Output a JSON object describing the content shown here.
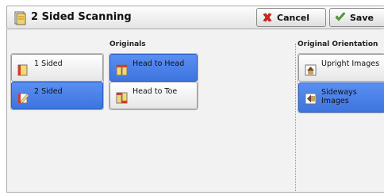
{
  "header": {
    "title": "2 Sided Scanning",
    "cancel_label": "Cancel",
    "save_label": "Save"
  },
  "sides": {
    "options": [
      {
        "label": "1 Sided",
        "selected": false
      },
      {
        "label": "2 Sided",
        "selected": true
      }
    ]
  },
  "originals": {
    "heading": "Originals",
    "options": [
      {
        "label": "Head to Head",
        "selected": true
      },
      {
        "label": "Head to Toe",
        "selected": false
      }
    ]
  },
  "orientation": {
    "heading": "Original Orientation",
    "options": [
      {
        "label": "Upright Images",
        "selected": false
      },
      {
        "label": "Sideways Images",
        "selected": true
      }
    ]
  },
  "colors": {
    "selected": "#4a82e8",
    "cancel_icon": "#d8261c",
    "save_icon": "#4caf2a"
  }
}
